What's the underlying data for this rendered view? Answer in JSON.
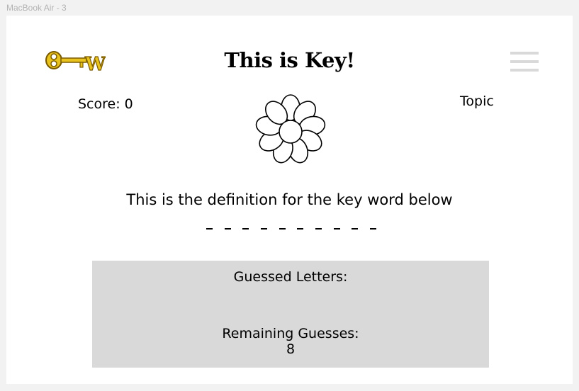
{
  "frame": {
    "label": "MacBook Air - 3"
  },
  "header": {
    "title": "This is Key!",
    "logo_icon": "key-w-logo-icon",
    "menu_icon": "hamburger-menu-icon"
  },
  "game": {
    "score_text": "Score: 0",
    "topic_label": "Topic",
    "progress_icon": "flower-icon",
    "definition": "This is the definition for the key word below",
    "word_length": 10,
    "guessed_label": "Guessed Letters:",
    "guessed_letters": "",
    "remaining_label": "Remaining Guesses:",
    "remaining_value": "8"
  },
  "colors": {
    "page_background": "#f2f2f2",
    "canvas_background": "#ffffff",
    "panel_background": "#d9d9d9",
    "menu_bar": "#d9d9d9",
    "logo_gold": "#e8c21d",
    "logo_outline": "#7a5a00",
    "text": "#000000"
  }
}
